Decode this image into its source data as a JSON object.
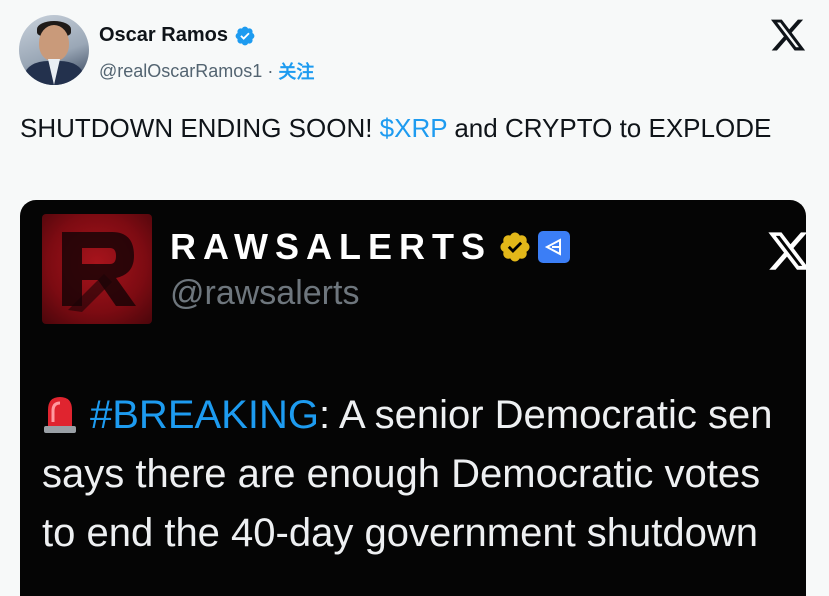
{
  "author": {
    "name": "Oscar Ramos",
    "handle": "@realOscarRamos1",
    "separator": "·",
    "follow_label": "关注"
  },
  "tweet": {
    "text_before": "SHUTDOWN ENDING SOON! ",
    "cashtag": "$XRP",
    "text_after": " and CRYPTO to EXPLODE"
  },
  "embedded": {
    "name": "RAWSALERTS",
    "handle": "@rawsalerts",
    "hashtag": "#BREAKING",
    "text_line1": ": A senior Democratic sen",
    "text_line2": "says there are enough Democratic votes",
    "text_line3": "to end the 40-day government shutdown"
  },
  "icons": {
    "platform": "x-logo-icon",
    "verified": "verified-badge-icon",
    "gold_verified": "gold-verified-badge-icon",
    "affiliate": "affiliate-badge-icon",
    "siren": "siren-emoji-icon"
  },
  "colors": {
    "accent": "#1d9bf0",
    "background": "#f7f9f9",
    "media_bg": "#050505",
    "logo_red": "#a8141c"
  }
}
